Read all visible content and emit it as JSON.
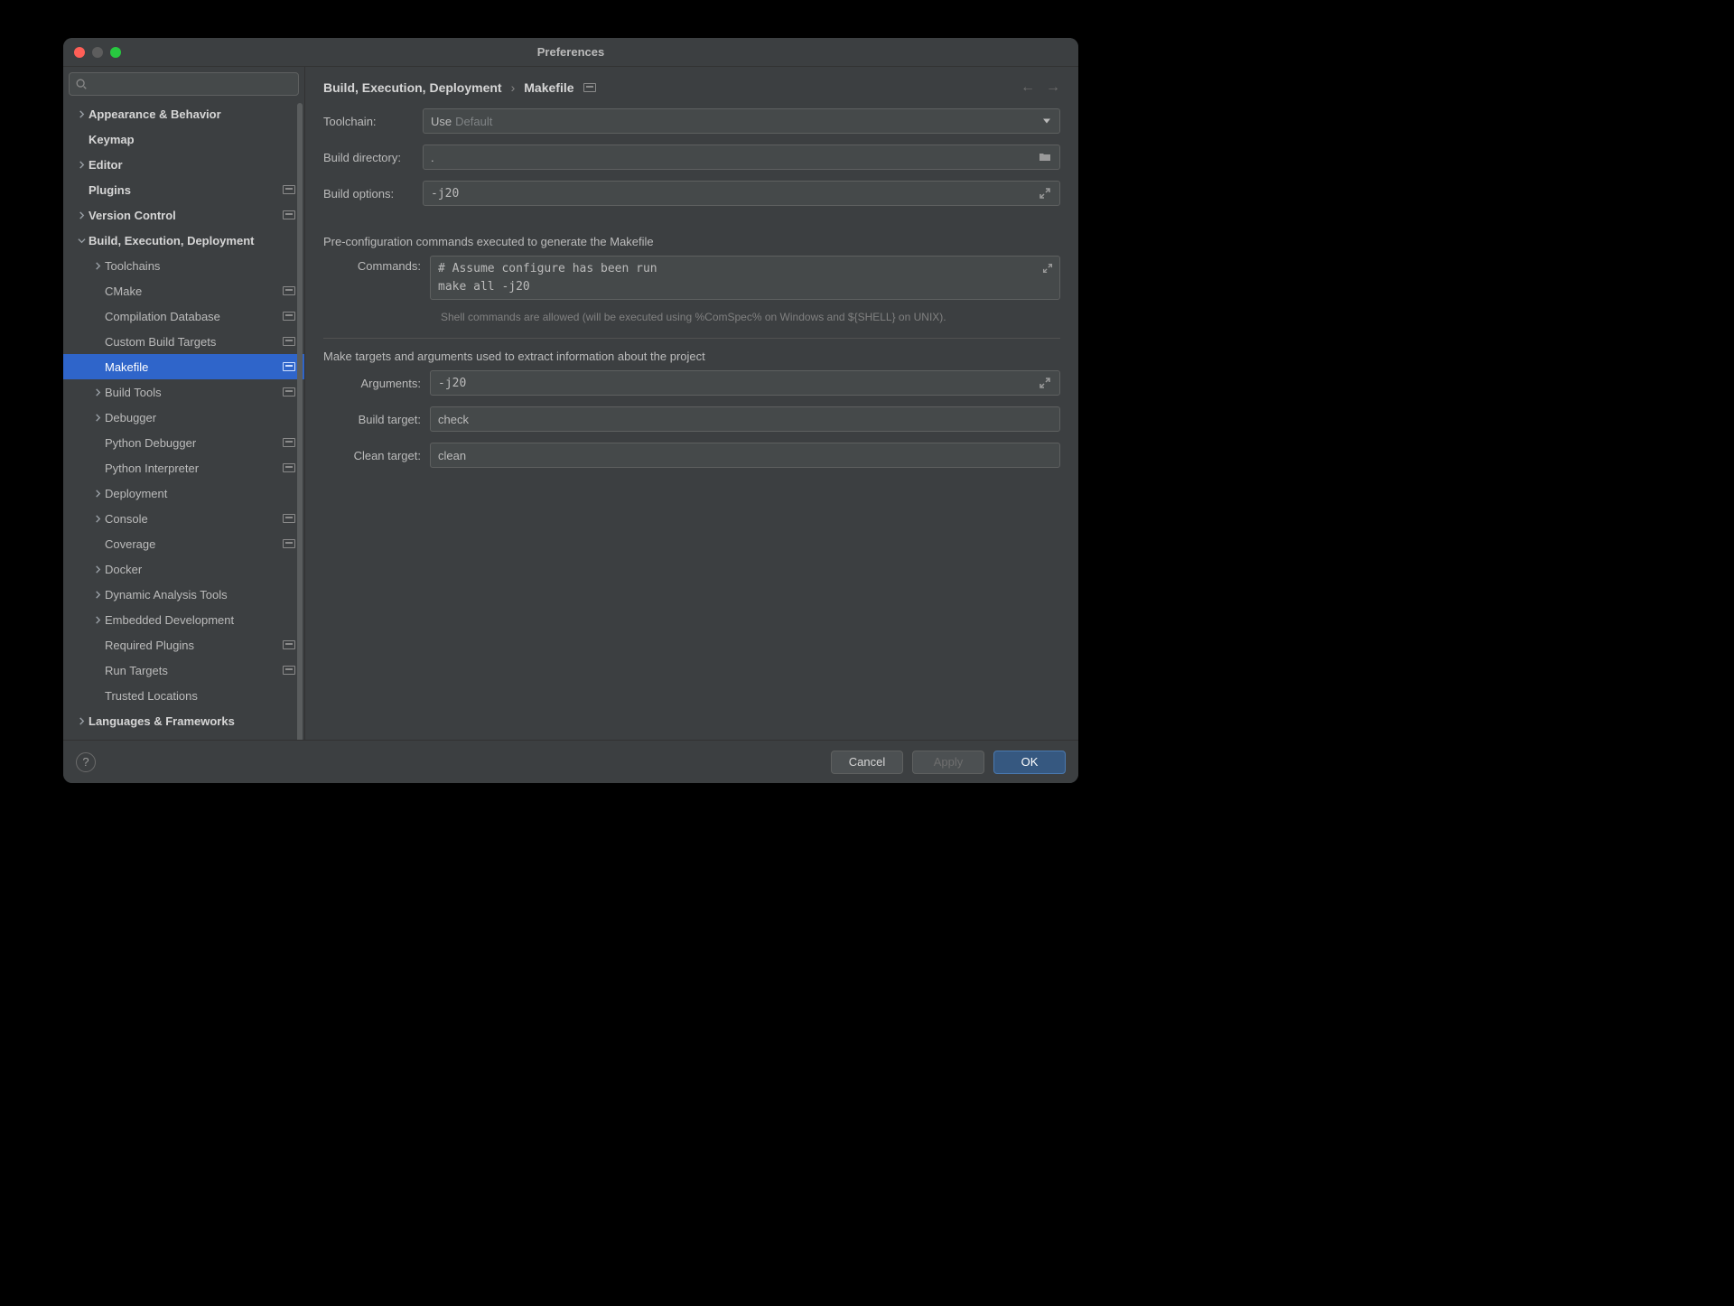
{
  "window": {
    "title": "Preferences"
  },
  "search": {
    "placeholder": ""
  },
  "tree": {
    "items": [
      {
        "label": "Appearance & Behavior",
        "depth": 0,
        "bold": true,
        "chev": "right",
        "badge": false
      },
      {
        "label": "Keymap",
        "depth": 0,
        "bold": true,
        "chev": "none",
        "badge": false
      },
      {
        "label": "Editor",
        "depth": 0,
        "bold": true,
        "chev": "right",
        "badge": false
      },
      {
        "label": "Plugins",
        "depth": 0,
        "bold": true,
        "chev": "none",
        "badge": true
      },
      {
        "label": "Version Control",
        "depth": 0,
        "bold": true,
        "chev": "right",
        "badge": true
      },
      {
        "label": "Build, Execution, Deployment",
        "depth": 0,
        "bold": true,
        "chev": "down",
        "badge": false
      },
      {
        "label": "Toolchains",
        "depth": 1,
        "bold": false,
        "chev": "right",
        "badge": false
      },
      {
        "label": "CMake",
        "depth": 1,
        "bold": false,
        "chev": "none",
        "badge": true
      },
      {
        "label": "Compilation Database",
        "depth": 1,
        "bold": false,
        "chev": "none",
        "badge": true
      },
      {
        "label": "Custom Build Targets",
        "depth": 1,
        "bold": false,
        "chev": "none",
        "badge": true
      },
      {
        "label": "Makefile",
        "depth": 1,
        "bold": false,
        "chev": "none",
        "badge": true,
        "selected": true
      },
      {
        "label": "Build Tools",
        "depth": 1,
        "bold": false,
        "chev": "right",
        "badge": true
      },
      {
        "label": "Debugger",
        "depth": 1,
        "bold": false,
        "chev": "right",
        "badge": false
      },
      {
        "label": "Python Debugger",
        "depth": 1,
        "bold": false,
        "chev": "none",
        "badge": true
      },
      {
        "label": "Python Interpreter",
        "depth": 1,
        "bold": false,
        "chev": "none",
        "badge": true
      },
      {
        "label": "Deployment",
        "depth": 1,
        "bold": false,
        "chev": "right",
        "badge": false
      },
      {
        "label": "Console",
        "depth": 1,
        "bold": false,
        "chev": "right",
        "badge": true
      },
      {
        "label": "Coverage",
        "depth": 1,
        "bold": false,
        "chev": "none",
        "badge": true
      },
      {
        "label": "Docker",
        "depth": 1,
        "bold": false,
        "chev": "right",
        "badge": false
      },
      {
        "label": "Dynamic Analysis Tools",
        "depth": 1,
        "bold": false,
        "chev": "right",
        "badge": false
      },
      {
        "label": "Embedded Development",
        "depth": 1,
        "bold": false,
        "chev": "right",
        "badge": false
      },
      {
        "label": "Required Plugins",
        "depth": 1,
        "bold": false,
        "chev": "none",
        "badge": true
      },
      {
        "label": "Run Targets",
        "depth": 1,
        "bold": false,
        "chev": "none",
        "badge": true
      },
      {
        "label": "Trusted Locations",
        "depth": 1,
        "bold": false,
        "chev": "none",
        "badge": false
      },
      {
        "label": "Languages & Frameworks",
        "depth": 0,
        "bold": true,
        "chev": "right",
        "badge": false
      }
    ]
  },
  "breadcrumb": {
    "parent": "Build, Execution, Deployment",
    "sep": "›",
    "current": "Makefile"
  },
  "form": {
    "toolchain_label": "Toolchain:",
    "toolchain_value": "Use",
    "toolchain_default": "Default",
    "build_dir_label": "Build directory:",
    "build_dir_value": ".",
    "build_opts_label": "Build options:",
    "build_opts_value": "-j20",
    "preconfig_heading": "Pre-configuration commands executed to generate the Makefile",
    "commands_label": "Commands:",
    "commands_value": "# Assume configure has been run\nmake all -j20",
    "commands_hint": "Shell commands are allowed (will be executed using %ComSpec% on Windows and ${SHELL} on UNIX).",
    "targets_heading": "Make targets and arguments used to extract information about the project",
    "arguments_label": "Arguments:",
    "arguments_value": "-j20",
    "build_target_label": "Build target:",
    "build_target_value": "check",
    "clean_target_label": "Clean target:",
    "clean_target_value": "clean"
  },
  "footer": {
    "cancel": "Cancel",
    "apply": "Apply",
    "ok": "OK"
  }
}
